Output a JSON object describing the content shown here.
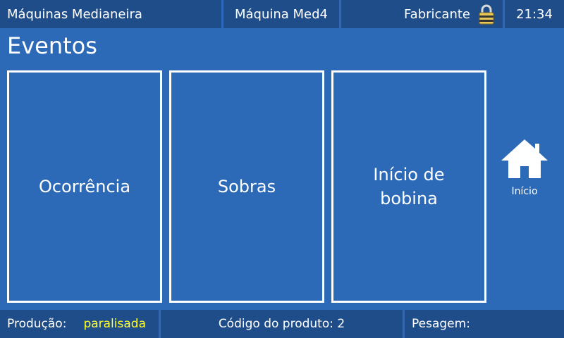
{
  "header": {
    "plant": "Máquinas Medianeira",
    "machine": "Máquina Med4",
    "user": "Fabricante",
    "user_icon": "lock-icon",
    "time": "21:34"
  },
  "page": {
    "title": "Eventos"
  },
  "tiles": [
    {
      "label": "Ocorrência"
    },
    {
      "label": "Sobras"
    },
    {
      "label": "Início de bobina"
    }
  ],
  "home": {
    "icon": "home-icon",
    "label": "Início"
  },
  "footer": {
    "production_label": "Produção:",
    "production_status": "paralisada",
    "production_status_color": "#ffff33",
    "product_code": "Código do produto: 2",
    "weighing_label": "Pesagem:"
  },
  "colors": {
    "background": "#2c6ab8",
    "bar": "#1e4d89",
    "tile_border": "#ffffff"
  }
}
